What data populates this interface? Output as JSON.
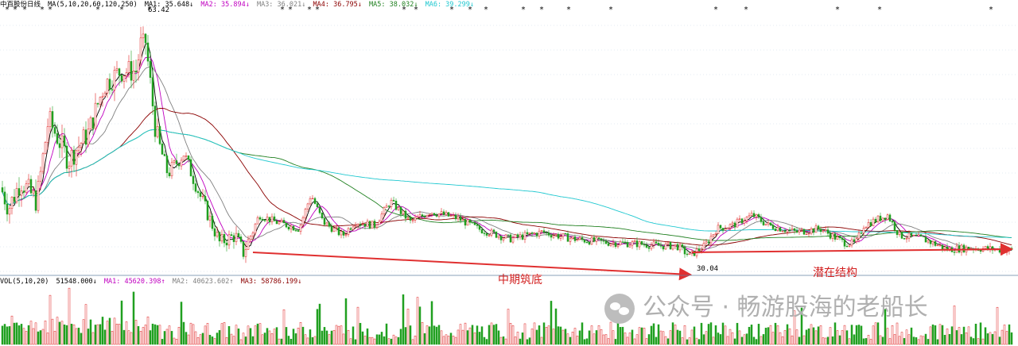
{
  "header": {
    "stock": "中百股份日线",
    "ma_title": "MA(5,10,20,60,120,250)",
    "ma": [
      {
        "label": "MA1: 35.648↓",
        "color": "#000000"
      },
      {
        "label": "MA2: 35.894↓",
        "color": "#c000c0"
      },
      {
        "label": "MA3: 36.021↓",
        "color": "#808080"
      },
      {
        "label": "MA4: 36.795↓",
        "color": "#8b0000"
      },
      {
        "label": "MA5: 38.032↓",
        "color": "#208020"
      },
      {
        "label": "MA6: 39.299↓",
        "color": "#20c8d0"
      }
    ]
  },
  "volume_header": {
    "title": "VOL(5,10,20)",
    "value": "51548.000↓",
    "ma": [
      {
        "label": "MA1: 45620.398↑",
        "color": "#c000c0"
      },
      {
        "label": "MA2: 40623.602↑",
        "color": "#808080"
      },
      {
        "label": "MA3: 58786.199↓",
        "color": "#8b0000"
      }
    ]
  },
  "labels": {
    "high": "63.42",
    "low": "30.04"
  },
  "annotations": {
    "left": "中期筑底",
    "right": "潜在结构"
  },
  "watermark": "公众号 · 畅游股海的老船长",
  "colors": {
    "up": "#e02020",
    "down": "#20a020",
    "arrow": "#e03030",
    "grid": "#c8d8e8"
  },
  "chart_data": {
    "type": "candlestick",
    "y_range": [
      28,
      66
    ],
    "price_high": 63.42,
    "price_low": 30.04,
    "trend_anchors": [
      [
        0,
        40
      ],
      [
        10,
        37
      ],
      [
        25,
        41
      ],
      [
        45,
        38
      ],
      [
        60,
        50
      ],
      [
        85,
        44
      ],
      [
        110,
        48
      ],
      [
        130,
        55
      ],
      [
        150,
        57
      ],
      [
        170,
        57
      ],
      [
        180,
        63.4
      ],
      [
        195,
        48
      ],
      [
        210,
        42
      ],
      [
        230,
        45
      ],
      [
        250,
        39
      ],
      [
        275,
        32
      ],
      [
        295,
        33
      ],
      [
        305,
        30.5
      ],
      [
        325,
        36
      ],
      [
        345,
        35
      ],
      [
        375,
        34
      ],
      [
        390,
        39
      ],
      [
        405,
        35
      ],
      [
        430,
        33
      ],
      [
        445,
        35
      ],
      [
        470,
        34.5
      ],
      [
        490,
        38
      ],
      [
        515,
        35
      ],
      [
        540,
        36.5
      ],
      [
        575,
        35.5
      ],
      [
        600,
        34
      ],
      [
        640,
        32.5
      ],
      [
        680,
        33.5
      ],
      [
        720,
        32.5
      ],
      [
        760,
        32
      ],
      [
        800,
        31.8
      ],
      [
        830,
        31.5
      ],
      [
        850,
        31.5
      ],
      [
        866,
        30.04
      ],
      [
        885,
        31.5
      ],
      [
        900,
        34
      ],
      [
        920,
        34.5
      ],
      [
        945,
        36
      ],
      [
        965,
        34.5
      ],
      [
        1000,
        33.5
      ],
      [
        1030,
        34
      ],
      [
        1060,
        32
      ],
      [
        1075,
        31.8
      ],
      [
        1085,
        34.5
      ],
      [
        1115,
        36
      ],
      [
        1130,
        33
      ],
      [
        1160,
        32.5
      ],
      [
        1190,
        31
      ],
      [
        1220,
        31.2
      ],
      [
        1250,
        31
      ],
      [
        1272,
        30.8
      ]
    ]
  }
}
